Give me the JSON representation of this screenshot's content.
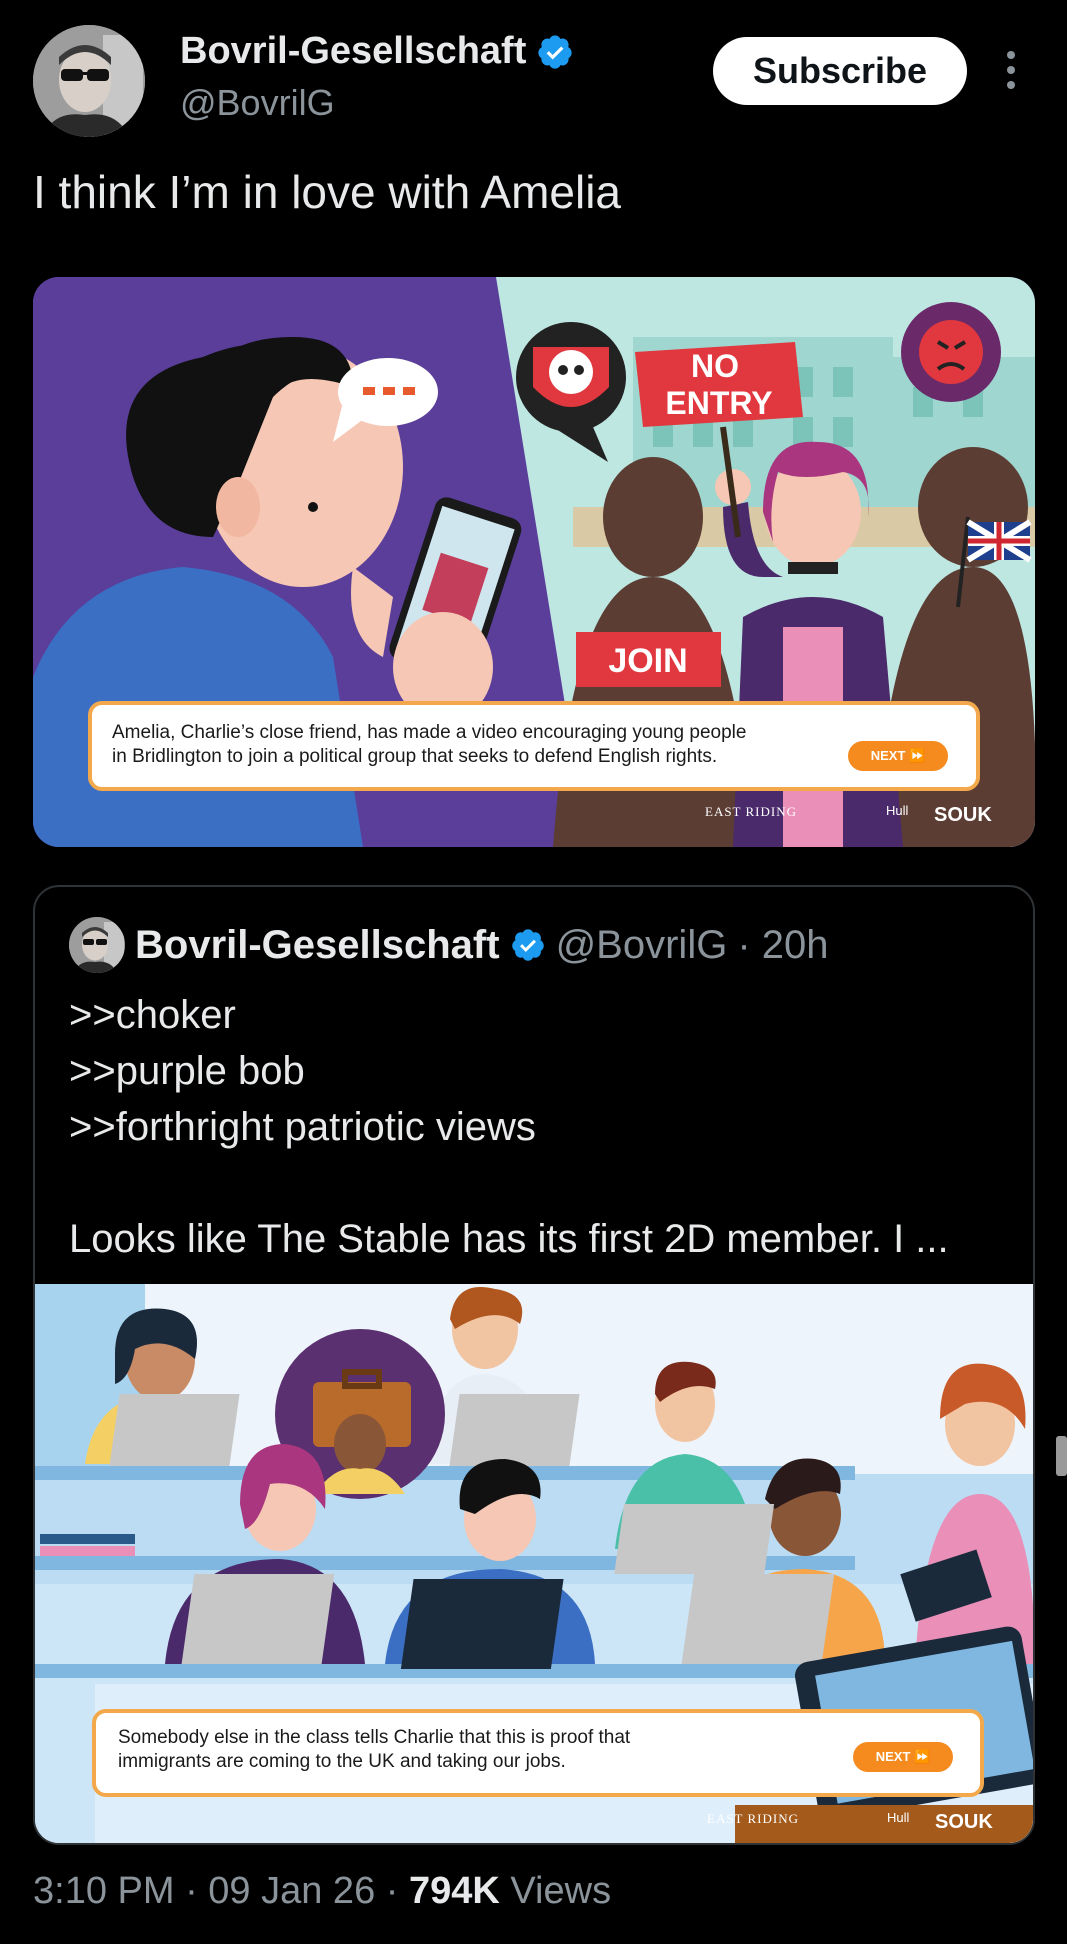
{
  "post": {
    "author_name": "Bovril-Gesellschaft",
    "author_handle": "@BovrilG",
    "subscribe_label": "Subscribe",
    "text": "I think I’m in love with Amelia",
    "media": {
      "caption": "Amelia, Charlie’s close friend, has made a video encouraging young people in Bridlington to join a political group that seeks to defend English rights.",
      "caption_line1": "Amelia, Charlie’s close friend, has made a video encouraging young people",
      "caption_line2": "in Bridlington to join a political group that seeks to defend English rights.",
      "next_label": "NEXT ⏩",
      "sign_text_1": "NO",
      "sign_text_2": "ENTRY",
      "join_text": "JOIN",
      "logo_east_riding": "EAST RIDING",
      "logo_hull": "Hull",
      "logo_souk": "SOUK"
    }
  },
  "quote": {
    "author_name": "Bovril-Gesellschaft",
    "author_handle": "@BovrilG",
    "time": "· 20h",
    "lines": [
      ">>choker",
      ">>purple bob",
      ">>forthright patriotic views",
      "",
      "Looks like The Stable has its first 2D member. I ..."
    ],
    "media": {
      "caption_line1": "Somebody else in the class tells Charlie that this is proof that",
      "caption_line2": "immigrants are coming to the UK and taking our jobs.",
      "next_label": "NEXT ⏩",
      "logo_east_riding": "EAST RIDING",
      "logo_hull": "Hull",
      "logo_souk": "SOUK"
    }
  },
  "footer": {
    "time": "3:10 PM · 09 Jan 26 · ",
    "views_count": "794K",
    "views_label": " Views"
  },
  "colors": {
    "background": "#000000",
    "verified": "#1d9bf0",
    "muted": "#8b949b",
    "accent_orange": "#f58a1f",
    "purple_panel": "#5a3e9a",
    "teal_panel": "#bfe7e2"
  }
}
